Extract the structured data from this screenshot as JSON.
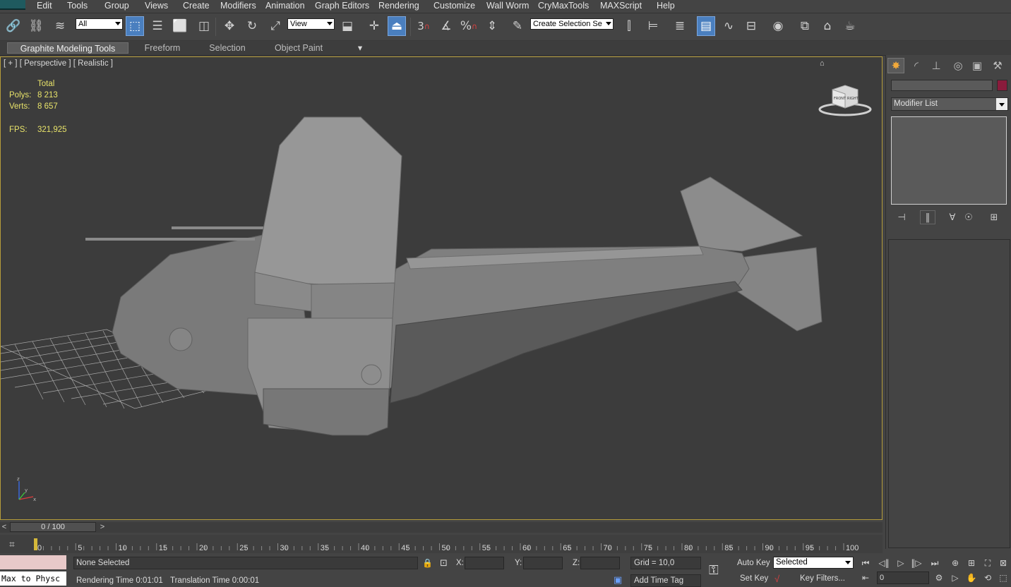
{
  "menubar": {
    "items": [
      "Edit",
      "Tools",
      "Group",
      "Views",
      "Create",
      "Modifiers",
      "Animation",
      "Graph Editors",
      "Rendering",
      "Customize",
      "Wall Worm",
      "CryMaxTools",
      "MAXScript",
      "Help"
    ]
  },
  "toolbar": {
    "filter_value": "All",
    "refcoord_value": "View",
    "named_selection_value": "Create Selection Se",
    "snap_label": "3",
    "percent_label": "%"
  },
  "ribbon": {
    "tabs": [
      "Graphite Modeling Tools",
      "Freeform",
      "Selection",
      "Object Paint"
    ]
  },
  "viewport": {
    "label": "[ + ] [ Perspective ] [ Realistic ]",
    "stats": {
      "total_label": "Total",
      "polys_label": "Polys:",
      "polys_value": "8 213",
      "verts_label": "Verts:",
      "verts_value": "8 657",
      "fps_label": "FPS:",
      "fps_value": "321,925"
    },
    "viewcube_front": "FRONT",
    "viewcube_right": "RIGHT",
    "axis_z": "z",
    "axis_x": "x",
    "axis_y": "y",
    "colors": {
      "border": "#b59c3a",
      "background": "#3c3c3c",
      "model": "#8e8e8e"
    }
  },
  "command_panel": {
    "modifier_list": "Modifier List",
    "object_color": "#8a1b3c"
  },
  "time_slider": {
    "position": "0 / 100",
    "left_arrow": "<",
    "right_arrow": ">"
  },
  "track_bar": {
    "ticks": [
      "0",
      "5",
      "10",
      "15",
      "20",
      "25",
      "30",
      "35",
      "40",
      "45",
      "50",
      "55",
      "60",
      "65",
      "70",
      "75",
      "80",
      "85",
      "90",
      "95",
      "100"
    ]
  },
  "status": {
    "maxscript_listener": "Max to Physc",
    "selection": "None Selected",
    "rendering_time": "Rendering Time  0:01:01",
    "translation_time": "Translation Time  0:00:01",
    "x_label": "X:",
    "y_label": "Y:",
    "z_label": "Z:",
    "grid": "Grid = 10,0",
    "add_time_tag": "Add Time Tag",
    "auto_key": "Auto Key",
    "set_key": "Set Key",
    "key_mode_value": "Selected",
    "key_filters": "Key Filters...",
    "current_frame": "0"
  }
}
